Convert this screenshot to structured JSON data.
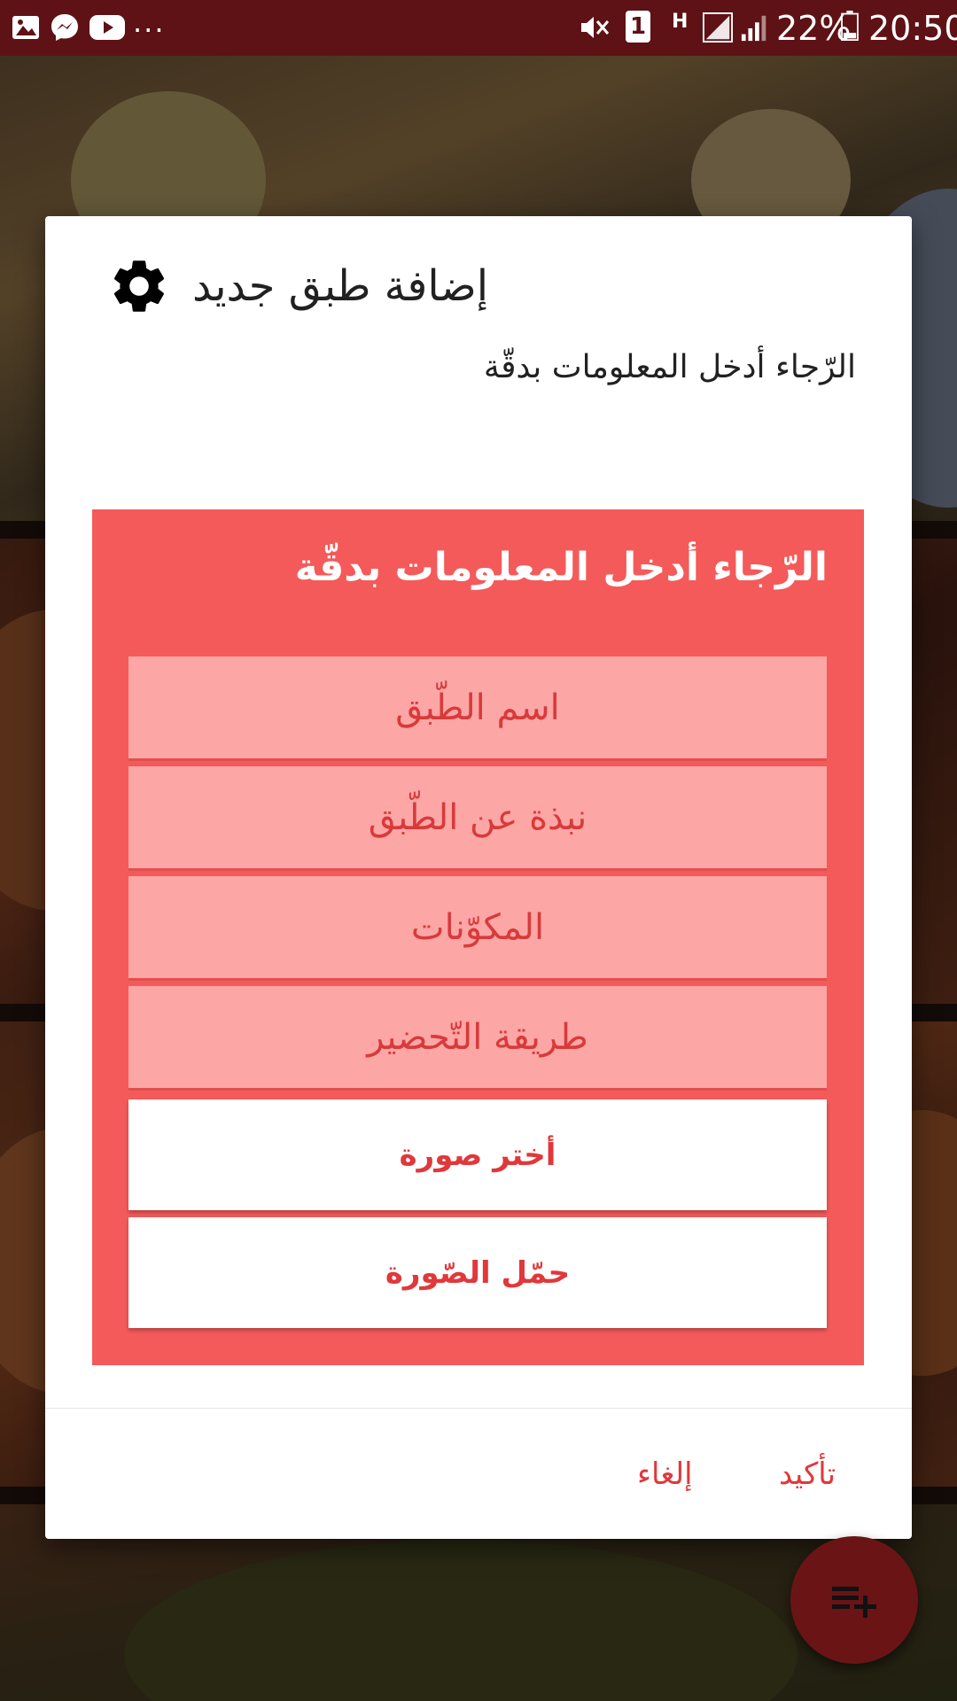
{
  "status_bar": {
    "more_indicator": "...",
    "sim_slot": "1",
    "network_type": "H",
    "battery_percent": "22%",
    "time": "20:50"
  },
  "dialog": {
    "title": "إضافة طبق جديد",
    "title_icon": "gear-icon",
    "message": "الرّجاء أدخل المعلومات بدقّة",
    "form": {
      "heading": "الرّجاء أدخل المعلومات بدقّة",
      "fields": {
        "dish_name": "اسم الطّبق",
        "about_dish": "نبذة عن الطّبق",
        "ingredients": "المكوّنات",
        "preparation": "طريقة التّحضير"
      },
      "choose_image_label": "أختر صورة",
      "upload_image_label": "حمّل الصّورة"
    },
    "actions": {
      "confirm": "تأكيد",
      "cancel": "إلغاء"
    }
  },
  "fab": {
    "icon": "playlist-add-icon"
  },
  "colors": {
    "status_bar": "#5e1215",
    "panel": "#f45a5a",
    "field": "#fca6a6",
    "accent": "#e0383b",
    "fab": "#6a1416"
  }
}
